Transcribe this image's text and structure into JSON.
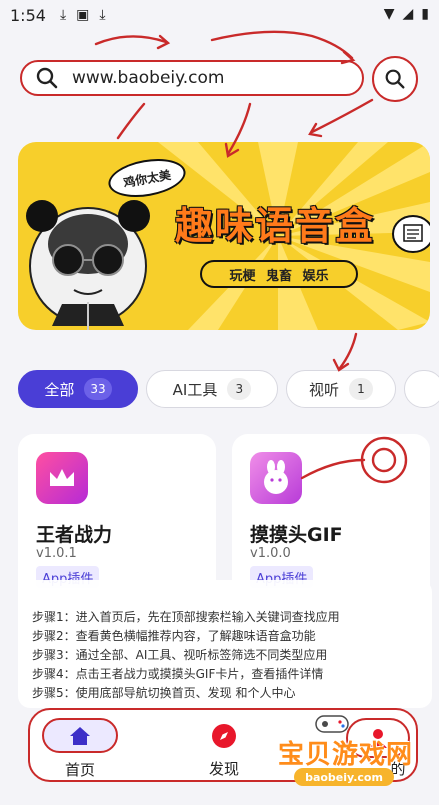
{
  "status_bar": {
    "time": "1:54"
  },
  "search": {
    "value": "www.baobeiy.com"
  },
  "banner": {
    "tag": "鸡你太美",
    "title": "趣味语音盒",
    "subtitle": "玩梗 鬼畜 娱乐"
  },
  "tabs": [
    {
      "label": "全部",
      "count": "33",
      "active": true
    },
    {
      "label": "AI工具",
      "count": "3",
      "active": false
    },
    {
      "label": "视听",
      "count": "1",
      "active": false
    }
  ],
  "apps": [
    {
      "name": "王者战力",
      "version": "v1.0.1",
      "type": "App插件"
    },
    {
      "name": "摸摸头GIF",
      "version": "v1.0.0",
      "type": "App插件"
    }
  ],
  "steps": [
    "步骤1：进入首页后，先在顶部搜索栏输入关键词查找应用",
    "步骤2：查看黄色横幅推荐内容，了解趣味语音盒功能",
    "步骤3：通过全部、AI工具、视听标签筛选不同类型应用",
    "步骤4：点击王者战力或摸摸头GIF卡片，查看插件详情",
    "步骤5：使用底部导航切换首页、发现 和个人中心"
  ],
  "bottom_nav": {
    "home": "首页",
    "discover": "发现",
    "me": "的"
  },
  "watermark": {
    "name": "宝贝游戏网",
    "url": "baobeiy.com"
  },
  "colors": {
    "accent": "#4a3ed6",
    "annotation": "#c92a2a",
    "banner": "#f7cf2b"
  }
}
